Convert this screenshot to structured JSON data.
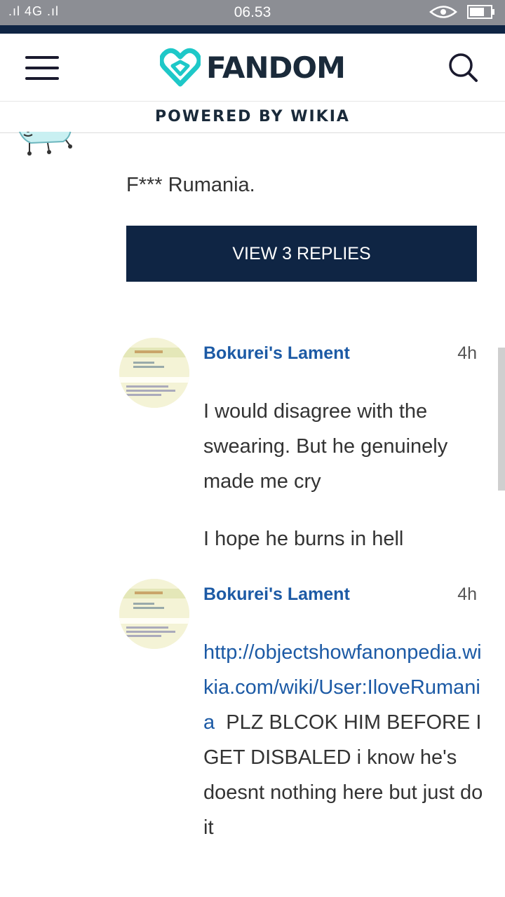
{
  "status_bar": {
    "signal": ".ıl 4G .ıl",
    "time": "06.53"
  },
  "header": {
    "logo_text": "FANDOM",
    "powered_by": "POWERED BY WIKIA"
  },
  "first_comment": {
    "text": "F*** Rumania.",
    "replies_button": "VIEW 3 REPLIES"
  },
  "comments": [
    {
      "author": "Bokurei's Lament",
      "time": "4h",
      "paragraphs": [
        "I would disagree with the swearing. But he genuinely made me cry",
        "I hope he burns in hell"
      ]
    },
    {
      "author": "Bokurei's Lament",
      "time": "4h",
      "link": "http://objectshowfanonpedia.wikia.com/wiki/User:IloveRumania",
      "text_after_link": "  PLZ BLCOK HIM BEFORE I GET DISBALED i know he's doesnt nothing here but just do it"
    }
  ],
  "colors": {
    "navy": "#0f2544",
    "link_blue": "#1c5aa5",
    "logo_teal": "#1ec8c8"
  }
}
